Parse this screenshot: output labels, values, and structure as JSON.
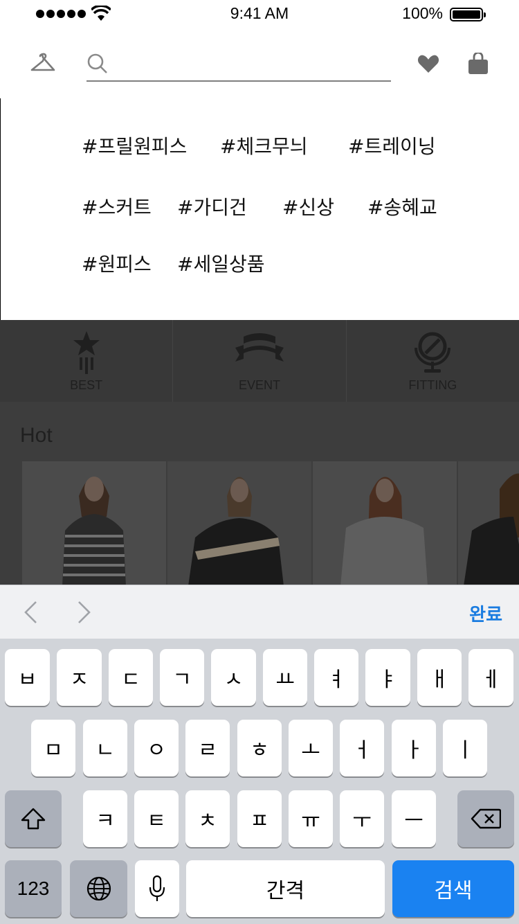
{
  "status_bar": {
    "time": "9:41 AM",
    "battery": "100%"
  },
  "header": {
    "search_placeholder": "",
    "search_value": ""
  },
  "suggestions": {
    "row1": [
      "#프릴원피스",
      "#체크무늬",
      "#트레이닝"
    ],
    "row2": [
      "#스커트",
      "#가디건",
      "#신상",
      "#송혜교"
    ],
    "row3": [
      "#원피스",
      "#세일상품"
    ]
  },
  "menu": {
    "best": "BEST",
    "event": "EVENT",
    "fitting": "FITTING"
  },
  "hot": {
    "title": "Hot"
  },
  "accessory": {
    "done": "완료"
  },
  "keyboard": {
    "row1": [
      "ㅂ",
      "ㅈ",
      "ㄷ",
      "ㄱ",
      "ㅅ",
      "ㅛ",
      "ㅕ",
      "ㅑ",
      "ㅐ",
      "ㅔ"
    ],
    "row2": [
      "ㅁ",
      "ㄴ",
      "ㅇ",
      "ㄹ",
      "ㅎ",
      "ㅗ",
      "ㅓ",
      "ㅏ",
      "ㅣ"
    ],
    "row3": [
      "ㅋ",
      "ㅌ",
      "ㅊ",
      "ㅍ",
      "ㅠ",
      "ㅜ",
      "ㅡ"
    ],
    "numbers": "123",
    "space": "간격",
    "search": "검색"
  },
  "colors": {
    "accent": "#1a82f1",
    "done_text": "#1a7ce0",
    "dim": "#3d3d3d"
  }
}
